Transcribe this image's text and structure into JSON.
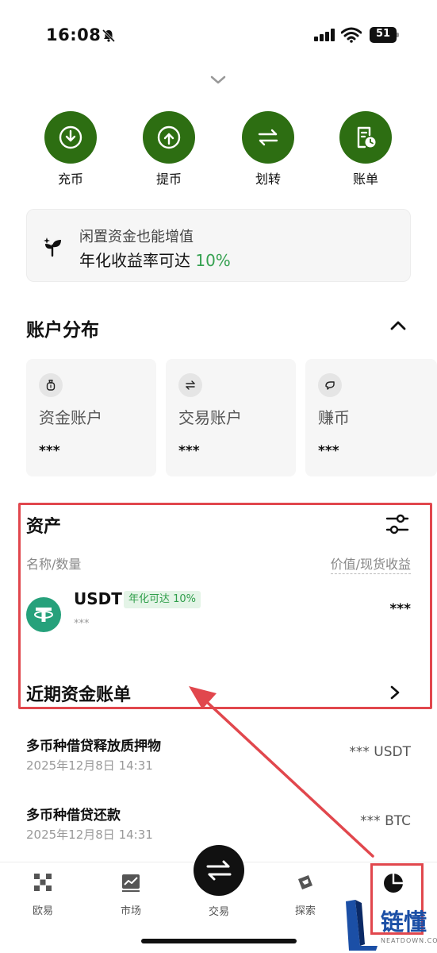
{
  "status_bar": {
    "time": "16:08",
    "battery": "51"
  },
  "quick_actions": [
    {
      "label": "充币",
      "icon": "deposit-icon"
    },
    {
      "label": "提币",
      "icon": "withdraw-icon"
    },
    {
      "label": "划转",
      "icon": "transfer-icon"
    },
    {
      "label": "账单",
      "icon": "bill-icon"
    }
  ],
  "banner": {
    "line1": "闲置资金也能增值",
    "line2": "年化收益率可达",
    "percent": "10%"
  },
  "distribution": {
    "title": "账户分布",
    "cards": [
      {
        "name": "资金账户",
        "value": "***",
        "icon": "money-bag-icon"
      },
      {
        "name": "交易账户",
        "value": "***",
        "icon": "transfer-small-icon"
      },
      {
        "name": "赚币",
        "value": "***",
        "icon": "earn-icon"
      }
    ]
  },
  "assets": {
    "title": "资产",
    "col_left": "名称/数量",
    "col_right": "价值/现货收益",
    "items": [
      {
        "symbol": "USDT",
        "badge": "年化可达 10%",
        "amount": "***",
        "value": "***"
      }
    ]
  },
  "bills": {
    "title": "近期资金账单",
    "items": [
      {
        "title": "多币种借贷释放质押物",
        "date": "2025年12月8日 14:31",
        "amount": "*** USDT"
      },
      {
        "title": "多币种借贷还款",
        "date": "2025年12月8日 14:31",
        "amount": "*** BTC"
      }
    ]
  },
  "nav": [
    {
      "label": "欧易",
      "icon": "okx-logo-icon"
    },
    {
      "label": "市场",
      "icon": "market-chart-icon"
    },
    {
      "label": "交易",
      "icon": "trade-swap-icon"
    },
    {
      "label": "探索",
      "icon": "compass-icon"
    },
    {
      "label": "",
      "icon": "assets-pie-icon"
    }
  ],
  "watermark": {
    "text": "链懂",
    "sub": "NEATDOWN.COM"
  },
  "colors": {
    "accent_green": "#2d6e12",
    "highlight_red": "#e1474d",
    "usdt": "#26a17b"
  }
}
